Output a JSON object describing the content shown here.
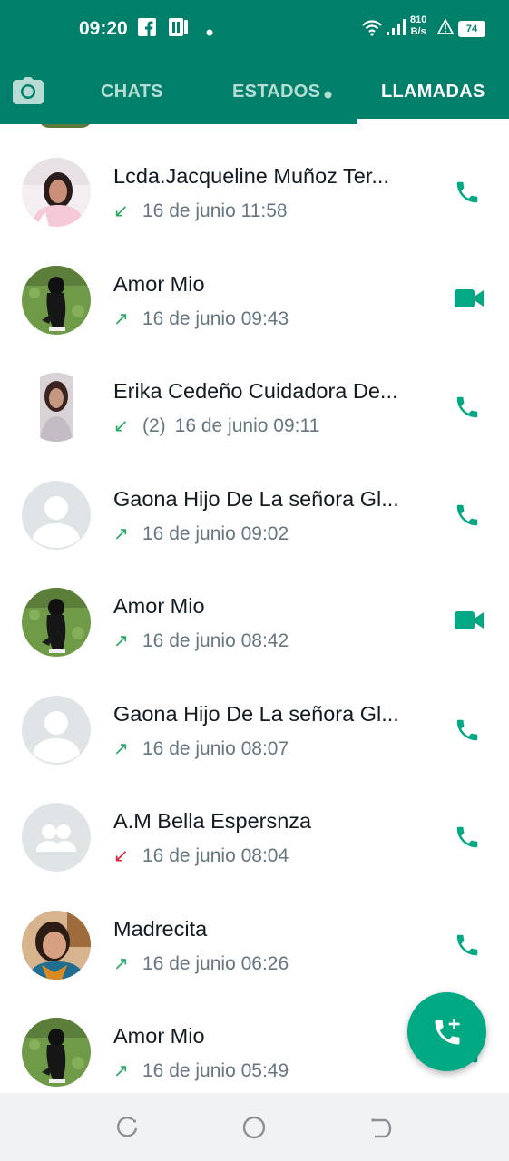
{
  "status_bar": {
    "time": "09:20",
    "net_speed_value": "810",
    "net_speed_unit": "B/s",
    "battery": "74"
  },
  "tabs": [
    {
      "label": "CHATS",
      "active": false
    },
    {
      "label": "ESTADOS",
      "active": false
    },
    {
      "label": "LLAMADAS",
      "active": true
    }
  ],
  "calls": [
    {
      "name": "Lcda.Jacqueline Muñoz Ter...",
      "direction": "incoming",
      "count": "",
      "time": "16 de junio 11:58",
      "type": "voice",
      "avatar": "photo-woman"
    },
    {
      "name": "Amor Mio",
      "direction": "outgoing",
      "count": "",
      "time": "16 de junio 09:43",
      "type": "video",
      "avatar": "photo-couple"
    },
    {
      "name": "Erika Cedeño Cuidadora De...",
      "direction": "incoming",
      "count": "(2)",
      "time": "16 de junio 09:11",
      "type": "voice",
      "avatar": "photo-woman2"
    },
    {
      "name": "Gaona Hijo De La señora Gl...",
      "direction": "outgoing",
      "count": "",
      "time": "16 de junio 09:02",
      "type": "voice",
      "avatar": "default-person"
    },
    {
      "name": "Amor Mio",
      "direction": "outgoing",
      "count": "",
      "time": "16 de junio 08:42",
      "type": "video",
      "avatar": "photo-couple"
    },
    {
      "name": "Gaona Hijo De La señora Gl...",
      "direction": "outgoing",
      "count": "",
      "time": "16 de junio 08:07",
      "type": "voice",
      "avatar": "default-person"
    },
    {
      "name": "A.M Bella Espersnza",
      "direction": "missed",
      "count": "",
      "time": "16 de junio 08:04",
      "type": "voice",
      "avatar": "default-group"
    },
    {
      "name": "Madrecita",
      "direction": "outgoing",
      "count": "",
      "time": "16 de junio 06:26",
      "type": "voice",
      "avatar": "photo-woman3"
    },
    {
      "name": "Amor Mio",
      "direction": "outgoing",
      "count": "",
      "time": "16 de junio 05:49",
      "type": "voice",
      "avatar": "photo-couple"
    }
  ],
  "colors": {
    "header": "#00806a",
    "accent": "#00a884",
    "incoming": "#25a861",
    "missed": "#e0213d"
  },
  "icons": {
    "camera": "camera-icon",
    "new_call": "add-call-icon",
    "voice": "phone-icon",
    "video": "video-call-icon"
  }
}
